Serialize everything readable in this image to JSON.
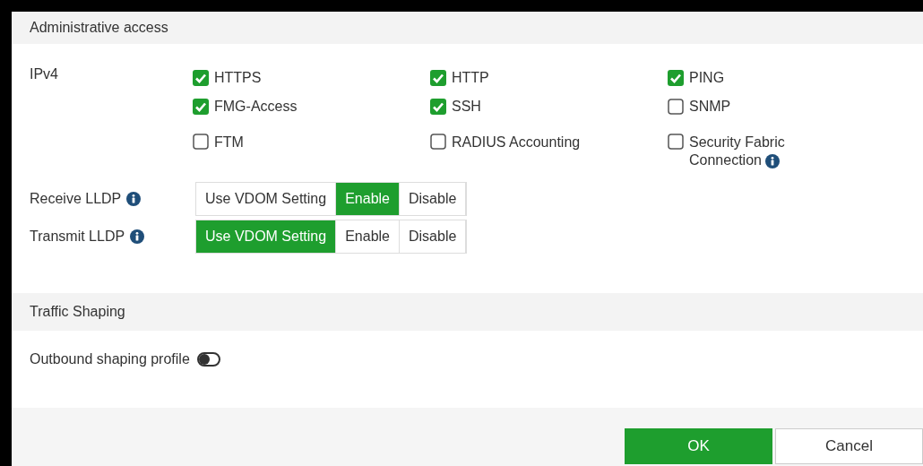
{
  "sections": [
    {
      "title": "Administrative access"
    }
  ],
  "ipv4": {
    "label": "IPv4",
    "options": [
      {
        "label": "HTTPS",
        "checked": true,
        "info": false
      },
      {
        "label": "HTTP",
        "checked": true,
        "info": false
      },
      {
        "label": "PING",
        "checked": true,
        "info": false
      },
      {
        "label": "FMG-Access",
        "checked": true,
        "info": false
      },
      {
        "label": "SSH",
        "checked": true,
        "info": false
      },
      {
        "label": "SNMP",
        "checked": false,
        "info": false
      },
      {
        "label": "FTM",
        "checked": false,
        "info": false
      },
      {
        "label": "RADIUS Accounting",
        "checked": false,
        "info": false
      },
      {
        "label": "Security Fabric Connection",
        "checked": false,
        "info": true
      }
    ]
  },
  "lldp": [
    {
      "label": "Receive LLDP",
      "options": [
        {
          "label": "Use VDOM Setting",
          "selected": false
        },
        {
          "label": "Enable",
          "selected": true
        },
        {
          "label": "Disable",
          "selected": false
        }
      ]
    },
    {
      "label": "Transmit LLDP",
      "options": [
        {
          "label": "Use VDOM Setting",
          "selected": true
        },
        {
          "label": "Enable",
          "selected": false
        },
        {
          "label": "Disable",
          "selected": false
        }
      ]
    }
  ],
  "traffic_shaping": {
    "title": "Traffic Shaping",
    "outbound": {
      "label": "Outbound shaping profile",
      "on": false
    }
  },
  "buttons": [
    {
      "label": "OK",
      "kind": "primary"
    },
    {
      "label": "Cancel",
      "kind": "secondary"
    }
  ]
}
